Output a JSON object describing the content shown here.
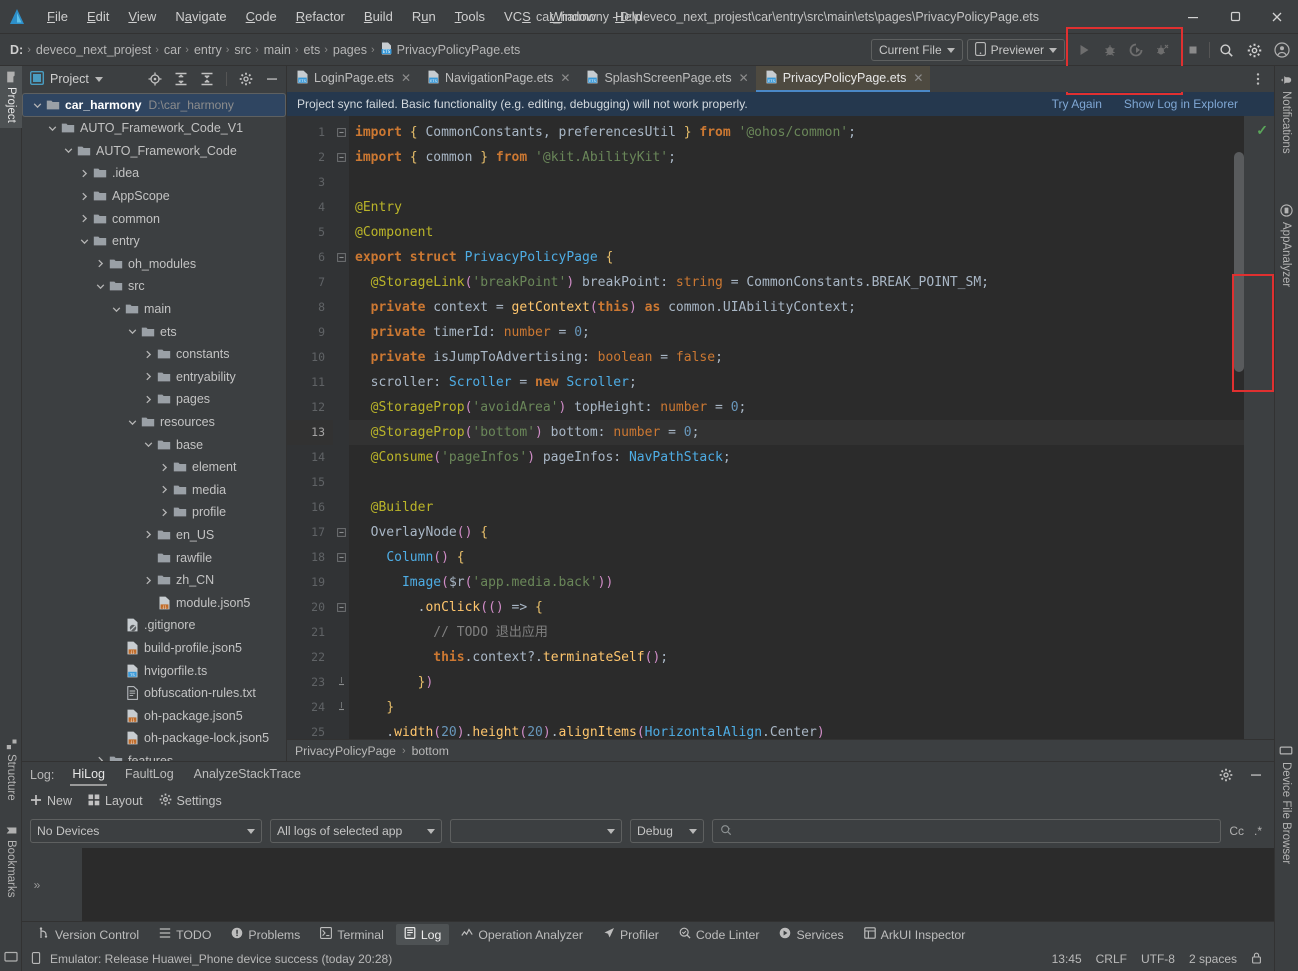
{
  "window": {
    "title": "car_harmony - D:\\deveco_next_projest\\car\\entry\\src\\main\\ets\\pages\\PrivacyPolicyPage.ets",
    "minimize": "—",
    "maximize": "❐",
    "close": "✕"
  },
  "menubar": {
    "items": [
      "File",
      "Edit",
      "View",
      "Navigate",
      "Code",
      "Refactor",
      "Build",
      "Run",
      "Tools",
      "VCS",
      "Window",
      "Help"
    ]
  },
  "breadcrumb": {
    "drive": "D:",
    "parts": [
      "deveco_next_projest",
      "car",
      "entry",
      "src",
      "main",
      "ets",
      "pages"
    ],
    "file": "PrivacyPolicyPage.ets",
    "separator": "›"
  },
  "toolbar": {
    "run_config": "Current File",
    "device": "Previewer",
    "run_title": "Run",
    "debug_title": "Debug",
    "profile_title": "Profile",
    "coverage_title": "Run with Coverage",
    "stop_title": "Stop",
    "search_title": "Search Everywhere",
    "settings_title": "Settings",
    "account_title": "Account"
  },
  "left_rail": {
    "items": [
      {
        "label": "Project",
        "icon": "folder-icon",
        "active": true
      },
      {
        "label": "Structure",
        "icon": "structure-icon",
        "active": false
      },
      {
        "label": "Bookmarks",
        "icon": "bookmark-icon",
        "active": false
      }
    ]
  },
  "right_rail": {
    "items": [
      {
        "label": "Notifications",
        "icon": "bell-icon"
      },
      {
        "label": "AppAnalyzer",
        "icon": "analyzer-icon"
      },
      {
        "label": "Device File Browser",
        "icon": "device-icon"
      }
    ]
  },
  "project_panel": {
    "title": "Project",
    "icons": [
      "locate-icon",
      "expand-all-icon",
      "collapse-all-icon",
      "gear-icon",
      "hide-icon"
    ],
    "tree": [
      {
        "label": "car_harmony",
        "path": "D:\\car_harmony",
        "depth": 0,
        "state": "open",
        "type": "folder",
        "selected": true,
        "bold": true
      },
      {
        "label": "AUTO_Framework_Code_V1",
        "depth": 1,
        "state": "open",
        "type": "folder"
      },
      {
        "label": "AUTO_Framework_Code",
        "depth": 2,
        "state": "open",
        "type": "folder"
      },
      {
        "label": ".idea",
        "depth": 3,
        "state": "closed",
        "type": "folder"
      },
      {
        "label": "AppScope",
        "depth": 3,
        "state": "closed",
        "type": "folder"
      },
      {
        "label": "common",
        "depth": 3,
        "state": "closed",
        "type": "folder"
      },
      {
        "label": "entry",
        "depth": 3,
        "state": "open",
        "type": "folder"
      },
      {
        "label": "oh_modules",
        "depth": 4,
        "state": "closed",
        "type": "folder"
      },
      {
        "label": "src",
        "depth": 4,
        "state": "open",
        "type": "folder"
      },
      {
        "label": "main",
        "depth": 5,
        "state": "open",
        "type": "folder"
      },
      {
        "label": "ets",
        "depth": 6,
        "state": "open",
        "type": "folder"
      },
      {
        "label": "constants",
        "depth": 7,
        "state": "closed",
        "type": "folder"
      },
      {
        "label": "entryability",
        "depth": 7,
        "state": "closed",
        "type": "folder"
      },
      {
        "label": "pages",
        "depth": 7,
        "state": "closed",
        "type": "folder"
      },
      {
        "label": "resources",
        "depth": 6,
        "state": "open",
        "type": "folder"
      },
      {
        "label": "base",
        "depth": 7,
        "state": "open",
        "type": "folder"
      },
      {
        "label": "element",
        "depth": 8,
        "state": "closed",
        "type": "folder"
      },
      {
        "label": "media",
        "depth": 8,
        "state": "closed",
        "type": "folder"
      },
      {
        "label": "profile",
        "depth": 8,
        "state": "closed",
        "type": "folder"
      },
      {
        "label": "en_US",
        "depth": 7,
        "state": "closed",
        "type": "folder"
      },
      {
        "label": "rawfile",
        "depth": 7,
        "state": "leaf",
        "type": "folder"
      },
      {
        "label": "zh_CN",
        "depth": 7,
        "state": "closed",
        "type": "folder"
      },
      {
        "label": "module.json5",
        "depth": 7,
        "state": "leaf",
        "type": "json5"
      },
      {
        "label": ".gitignore",
        "depth": 5,
        "state": "leaf",
        "type": "gitignore"
      },
      {
        "label": "build-profile.json5",
        "depth": 5,
        "state": "leaf",
        "type": "json5"
      },
      {
        "label": "hvigorfile.ts",
        "depth": 5,
        "state": "leaf",
        "type": "ts"
      },
      {
        "label": "obfuscation-rules.txt",
        "depth": 5,
        "state": "leaf",
        "type": "txt"
      },
      {
        "label": "oh-package.json5",
        "depth": 5,
        "state": "leaf",
        "type": "json5"
      },
      {
        "label": "oh-package-lock.json5",
        "depth": 5,
        "state": "leaf",
        "type": "json5"
      },
      {
        "label": "features",
        "depth": 4,
        "state": "closed",
        "type": "folder"
      }
    ]
  },
  "editor": {
    "tabs": [
      {
        "label": "LoginPage.ets",
        "active": false
      },
      {
        "label": "NavigationPage.ets",
        "active": false
      },
      {
        "label": "SplashScreenPage.ets",
        "active": false
      },
      {
        "label": "PrivacyPolicyPage.ets",
        "active": true
      }
    ],
    "tab_close": "✕",
    "notification": {
      "message": "Project sync failed. Basic functionality (e.g. editing, debugging) will not work properly.",
      "links": [
        "Try Again",
        "Show Log in Explorer"
      ]
    },
    "inspection_status": "✓",
    "current_line": 13,
    "breadcrumb": {
      "parts": [
        "PrivacyPolicyPage",
        "bottom"
      ],
      "separator": "›"
    },
    "lines": [
      {
        "n": 1,
        "fold": "minus"
      },
      {
        "n": 2,
        "fold": "minus"
      },
      {
        "n": 3,
        "fold": ""
      },
      {
        "n": 4,
        "fold": ""
      },
      {
        "n": 5,
        "fold": ""
      },
      {
        "n": 6,
        "fold": "minus"
      },
      {
        "n": 7,
        "fold": ""
      },
      {
        "n": 8,
        "fold": ""
      },
      {
        "n": 9,
        "fold": ""
      },
      {
        "n": 10,
        "fold": ""
      },
      {
        "n": 11,
        "fold": ""
      },
      {
        "n": 12,
        "fold": ""
      },
      {
        "n": 13,
        "fold": ""
      },
      {
        "n": 14,
        "fold": ""
      },
      {
        "n": 15,
        "fold": ""
      },
      {
        "n": 16,
        "fold": ""
      },
      {
        "n": 17,
        "fold": "minus"
      },
      {
        "n": 18,
        "fold": "minus"
      },
      {
        "n": 19,
        "fold": ""
      },
      {
        "n": 20,
        "fold": "minus"
      },
      {
        "n": 21,
        "fold": ""
      },
      {
        "n": 22,
        "fold": ""
      },
      {
        "n": 23,
        "fold": "end"
      },
      {
        "n": 24,
        "fold": "end"
      },
      {
        "n": 25,
        "fold": ""
      }
    ],
    "source_text": [
      "import { CommonConstants, preferencesUtil } from '@ohos/common';",
      "import { common } from '@kit.AbilityKit';",
      "",
      "@Entry",
      "@Component",
      "export struct PrivacyPolicyPage {",
      "  @StorageLink('breakPoint') breakPoint: string = CommonConstants.BREAK_POINT_SM;",
      "  private context = getContext(this) as common.UIAbilityContext;",
      "  private timerId: number = 0;",
      "  private isJumpToAdvertising: boolean = false;",
      "  scroller: Scroller = new Scroller;",
      "  @StorageProp('avoidArea') topHeight: number = 0;",
      "  @StorageProp('bottom') bottom: number = 0;",
      "  @Consume('pageInfos') pageInfos: NavPathStack;",
      "",
      "  @Builder",
      "  OverlayNode() {",
      "    Column() {",
      "      Image($r('app.media.back'))",
      "        .onClick(() => {",
      "          // TODO 退出应用",
      "          this.context?.terminateSelf();",
      "        })",
      "    }",
      "    .width(20).height(20).alignItems(HorizontalAlign.Center)"
    ]
  },
  "log_panel": {
    "label": "Log:",
    "tabs": [
      {
        "label": "HiLog",
        "active": true
      },
      {
        "label": "FaultLog",
        "active": false
      },
      {
        "label": "AnalyzeStackTrace",
        "active": false
      }
    ],
    "actions": [
      {
        "label": "New",
        "icon": "plus-icon"
      },
      {
        "label": "Layout",
        "icon": "layout-icon"
      },
      {
        "label": "Settings",
        "icon": "gear-icon"
      }
    ],
    "filters": {
      "device": "No Devices",
      "app": "All logs of selected app",
      "process": "",
      "level": "Debug",
      "search_placeholder": "",
      "search_value": "",
      "match_case": "Cc",
      "regex": ".*"
    },
    "panel_icons": [
      "gear-icon",
      "hide-icon"
    ],
    "expand_chevron": "»"
  },
  "toolwindow_bar": {
    "items": [
      {
        "label": "Version Control",
        "icon": "branch-icon",
        "active": false
      },
      {
        "label": "TODO",
        "icon": "todo-icon",
        "active": false
      },
      {
        "label": "Problems",
        "icon": "problems-icon",
        "active": false
      },
      {
        "label": "Terminal",
        "icon": "terminal-icon",
        "active": false
      },
      {
        "label": "Log",
        "icon": "log-icon",
        "active": true
      },
      {
        "label": "Operation Analyzer",
        "icon": "operation-analyzer-icon",
        "active": false
      },
      {
        "label": "Profiler",
        "icon": "profiler-icon",
        "active": false
      },
      {
        "label": "Code Linter",
        "icon": "code-linter-icon",
        "active": false
      },
      {
        "label": "Services",
        "icon": "services-icon",
        "active": false
      },
      {
        "label": "ArkUI Inspector",
        "icon": "arkui-inspector-icon",
        "active": false
      }
    ]
  },
  "statusbar": {
    "message": "Emulator: Release Huawei_Phone device success (today 20:28)",
    "icon": "device-icon",
    "position": "13:45",
    "line_separator": "CRLF",
    "encoding": "UTF-8",
    "indent": "2 spaces",
    "lock": "🔒"
  },
  "colors": {
    "accent": "#4a88c7",
    "highlight_box": "#e03030",
    "sync_bar": "#25384e",
    "tab_active": "#4e4a40",
    "editor_bg": "#2b2b2b",
    "panel_bg": "#3c3f41"
  }
}
